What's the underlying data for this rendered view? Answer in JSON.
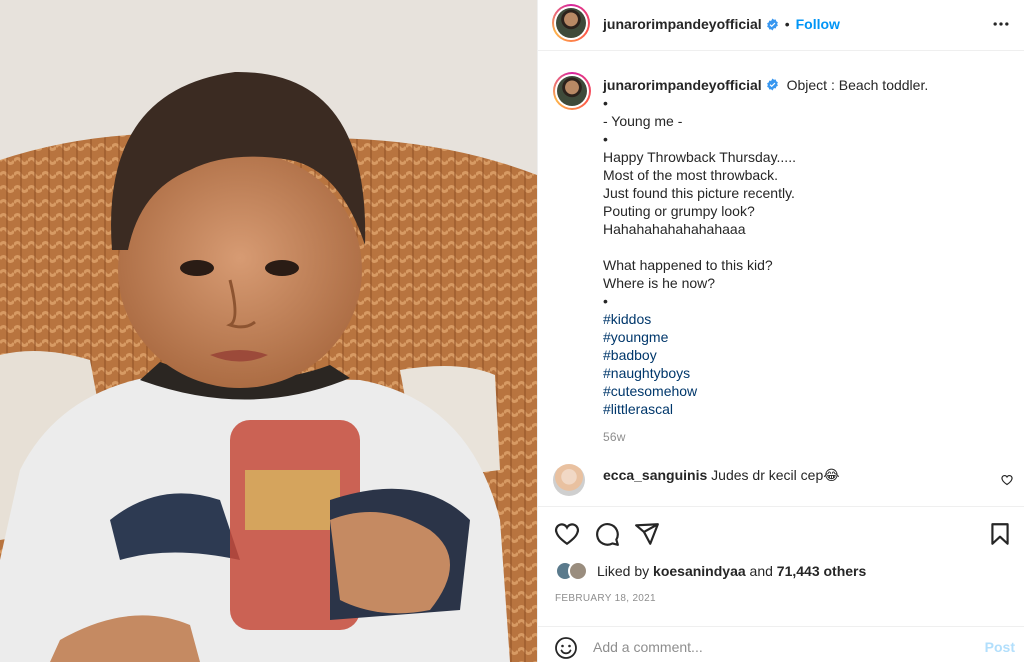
{
  "post": {
    "username": "junarorimpandeyofficial",
    "follow_label": "Follow",
    "separator": "•",
    "caption_first": "Object : Beach toddler.",
    "caption_lines": [
      "•",
      "- Young me -",
      "•",
      "Happy Throwback Thursday.....",
      "Most of the most throwback.",
      "Just found this picture recently.",
      "Pouting or grumpy look?",
      "Hahahahahahahahaaa",
      "",
      "What happened to this kid?",
      "Where is he now?",
      "•"
    ],
    "hashtags": [
      "#kiddos",
      "#youngme",
      "#badboy",
      "#naughtyboys",
      "#cutesomehow",
      "#littlerascal"
    ],
    "time_ago": "56w"
  },
  "comment": {
    "username": "ecca_sanguinis",
    "text": "Judes dr kecil cep😂"
  },
  "likes": {
    "prefix": "Liked by",
    "user": "koesanindyaa",
    "and": "and",
    "count": "71,443 others"
  },
  "date": "FEBRUARY 18, 2021",
  "add_comment": {
    "placeholder": "Add a comment...",
    "post_label": "Post"
  },
  "icons": {
    "verified": "verified-badge-icon",
    "more": "more-options-icon",
    "like": "heart-icon",
    "comment": "comment-icon",
    "share": "share-icon",
    "save": "bookmark-icon",
    "emoji": "emoji-icon"
  },
  "colors": {
    "link": "#0095f6",
    "hashtag": "#00376b",
    "muted": "#8e8e8e",
    "post_disabled": "#b2dffc"
  }
}
